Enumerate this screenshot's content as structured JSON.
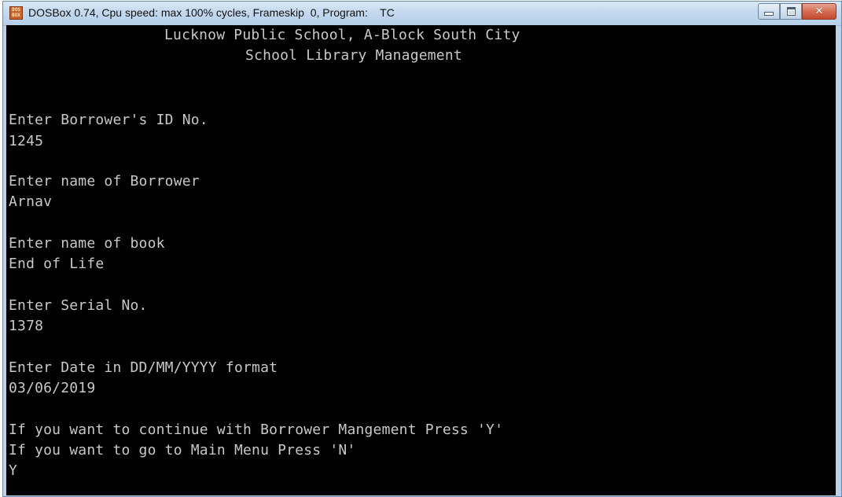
{
  "window": {
    "title": "DOSBox 0.74, Cpu speed: max 100% cycles, Frameskip  0, Program:    TC",
    "icon": "dosbox-icon",
    "icon_text": "DOS BOX",
    "buttons": {
      "minimize": "minimize-icon",
      "maximize": "maximize-icon",
      "close": "close-icon",
      "close_glyph": "✕"
    }
  },
  "console": {
    "header1": "Lucknow Public School, A-Block South City",
    "header2": "School Library Management",
    "borrower_id_prompt": "Enter Borrower's ID No.",
    "borrower_id_value": "1245",
    "borrower_name_prompt": "Enter name of Borrower",
    "borrower_name_value": "Arnav",
    "book_name_prompt": "Enter name of book",
    "book_name_value": "End of Life",
    "serial_prompt": "Enter Serial No.",
    "serial_value": "1378",
    "date_prompt": "Enter Date in DD/MM/YYYY format",
    "date_value": "03/06/2019",
    "continue_prompt": "If you want to continue with Borrower Mangement Press 'Y'",
    "menu_prompt": "If you want to go to Main Menu Press 'N'",
    "choice_value": "Y"
  }
}
